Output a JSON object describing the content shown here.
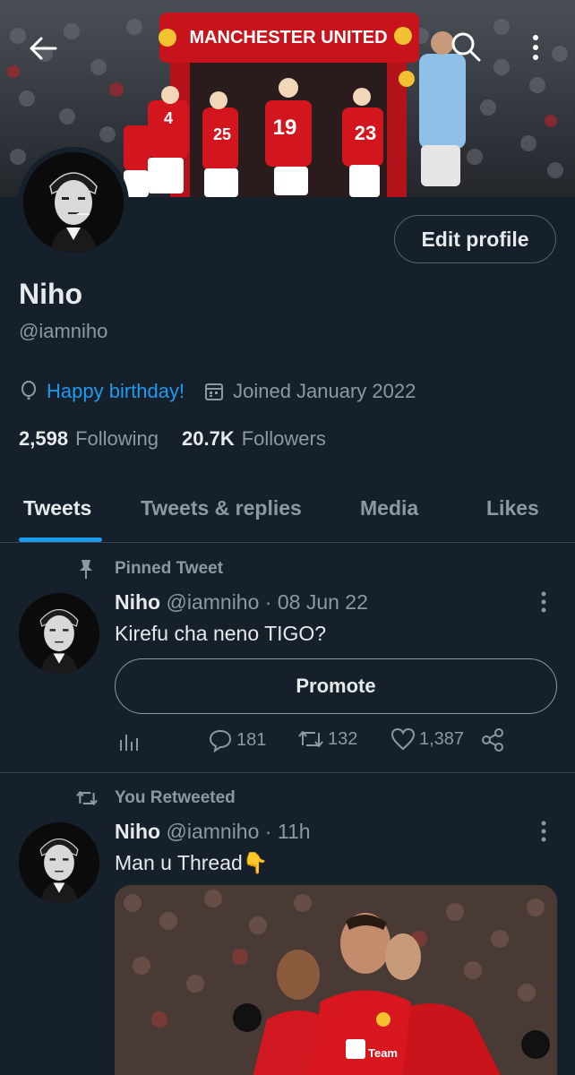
{
  "colors": {
    "background": "#15202b",
    "accent": "#1d9bf0",
    "muted": "#8b98a5",
    "border": "#38444d",
    "united_red": "#c7141c"
  },
  "header": {
    "banner_sign": "MANCHESTER UNITED",
    "back_icon": "arrow-left-icon",
    "search_icon": "search-icon",
    "more_icon": "more-vertical-icon"
  },
  "profile": {
    "name": "Niho",
    "handle": "@iamniho",
    "edit_label": "Edit profile",
    "birthday_icon": "balloon-icon",
    "birthday": "Happy birthday!",
    "calendar_icon": "calendar-icon",
    "joined": "Joined January 2022",
    "following_count": "2,598",
    "following_label": "Following",
    "followers_count": "20.7K",
    "followers_label": "Followers"
  },
  "tabs": [
    {
      "label": "Tweets",
      "active": true
    },
    {
      "label": "Tweets & replies",
      "active": false
    },
    {
      "label": "Media",
      "active": false
    },
    {
      "label": "Likes",
      "active": false
    }
  ],
  "tweets": [
    {
      "context": "Pinned Tweet",
      "context_icon": "pin-icon",
      "author": "Niho",
      "handle": "@iamniho",
      "time": "08 Jun 22",
      "text": "Kirefu cha neno TIGO?",
      "promote_label": "Promote",
      "stats": {
        "replies": "181",
        "retweets": "132",
        "likes": "1,387"
      }
    },
    {
      "context": "You Retweeted",
      "context_icon": "retweet-icon",
      "author": "Niho",
      "handle": "@iamniho",
      "time": "11h",
      "text": "Man u Thread",
      "emoji": "👇"
    }
  ]
}
